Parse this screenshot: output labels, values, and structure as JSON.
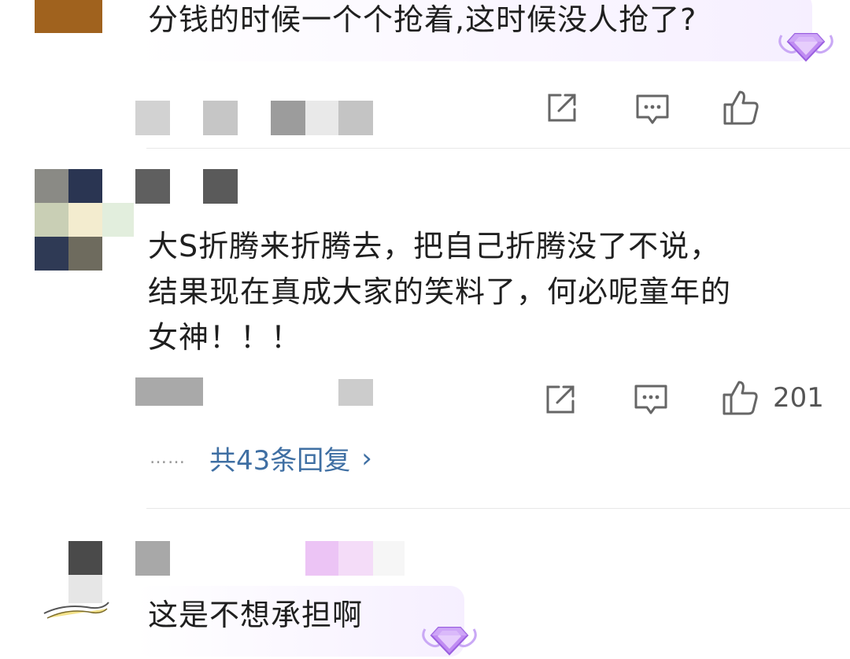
{
  "comments": [
    {
      "text": "分钱的时候一个个抢着,这时候没人抢了?",
      "actions": {
        "share_icon": "share-icon",
        "reply_icon": "comment-icon",
        "like_icon": "thumbs-up-icon",
        "like_count": ""
      }
    },
    {
      "lines": [
        "大S折腾来折腾去，把自己折腾没了不说，",
        "结果现在真成大家的笑料了，何必呢童年的",
        "女神！！！"
      ],
      "actions": {
        "share_icon": "share-icon",
        "reply_icon": "comment-icon",
        "like_icon": "thumbs-up-icon",
        "like_count": "201"
      },
      "replies": {
        "dots": "……",
        "label": "共43条回复",
        "chevron": "›"
      }
    },
    {
      "text": "这是不想承担啊"
    }
  ],
  "colors": {
    "reply_link": "#3f6fa3",
    "badge": "#b78cf0"
  }
}
